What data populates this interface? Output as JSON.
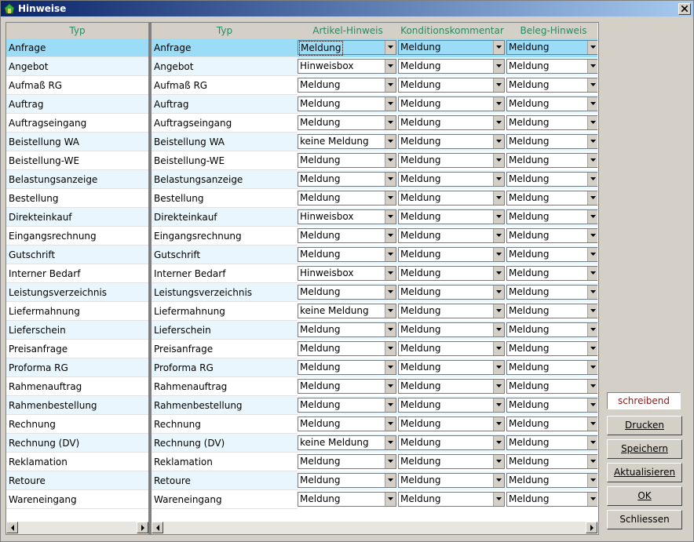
{
  "window": {
    "title": "Hinweise"
  },
  "columns": {
    "frozen_typ": "Typ",
    "typ": "Typ",
    "artikel": "Artikel-Hinweis",
    "kondition": "Konditionskommentar",
    "beleg": "Beleg-Hinweis"
  },
  "rows": [
    {
      "frozen": "Anfrage",
      "typ": "Anfrage",
      "artikel": "Meldung",
      "kondition": "Meldung",
      "beleg": "Meldung"
    },
    {
      "frozen": "Angebot",
      "typ": "Angebot",
      "artikel": "Hinweisbox",
      "kondition": "Meldung",
      "beleg": "Meldung"
    },
    {
      "frozen": "Aufmaß RG",
      "typ": "Aufmaß RG",
      "artikel": "Meldung",
      "kondition": "Meldung",
      "beleg": "Meldung"
    },
    {
      "frozen": "Auftrag",
      "typ": "Auftrag",
      "artikel": "Meldung",
      "kondition": "Meldung",
      "beleg": "Meldung"
    },
    {
      "frozen": "Auftragseingang",
      "typ": "Auftragseingang",
      "artikel": "Meldung",
      "kondition": "Meldung",
      "beleg": "Meldung"
    },
    {
      "frozen": "Beistellung WA",
      "typ": "Beistellung WA",
      "artikel": "keine Meldung",
      "kondition": "Meldung",
      "beleg": "Meldung"
    },
    {
      "frozen": "Beistellung-WE",
      "typ": "Beistellung-WE",
      "artikel": "Meldung",
      "kondition": "Meldung",
      "beleg": "Meldung"
    },
    {
      "frozen": "Belastungsanzeige",
      "typ": "Belastungsanzeige",
      "artikel": "Meldung",
      "kondition": "Meldung",
      "beleg": "Meldung"
    },
    {
      "frozen": "Bestellung",
      "typ": "Bestellung",
      "artikel": "Meldung",
      "kondition": "Meldung",
      "beleg": "Meldung"
    },
    {
      "frozen": "Direkteinkauf",
      "typ": "Direkteinkauf",
      "artikel": "Hinweisbox",
      "kondition": "Meldung",
      "beleg": "Meldung"
    },
    {
      "frozen": "Eingangsrechnung",
      "typ": "Eingangsrechnung",
      "artikel": "Meldung",
      "kondition": "Meldung",
      "beleg": "Meldung"
    },
    {
      "frozen": "Gutschrift",
      "typ": "Gutschrift",
      "artikel": "Meldung",
      "kondition": "Meldung",
      "beleg": "Meldung"
    },
    {
      "frozen": "Interner Bedarf",
      "typ": "Interner Bedarf",
      "artikel": "Hinweisbox",
      "kondition": "Meldung",
      "beleg": "Meldung"
    },
    {
      "frozen": "Leistungsverzeichnis",
      "typ": "Leistungsverzeichnis",
      "artikel": "Meldung",
      "kondition": "Meldung",
      "beleg": "Meldung"
    },
    {
      "frozen": "Liefermahnung",
      "typ": "Liefermahnung",
      "artikel": "keine Meldung",
      "kondition": "Meldung",
      "beleg": "Meldung"
    },
    {
      "frozen": "Lieferschein",
      "typ": "Lieferschein",
      "artikel": "Meldung",
      "kondition": "Meldung",
      "beleg": "Meldung"
    },
    {
      "frozen": "Preisanfrage",
      "typ": "Preisanfrage",
      "artikel": "Meldung",
      "kondition": "Meldung",
      "beleg": "Meldung"
    },
    {
      "frozen": "Proforma RG",
      "typ": "Proforma RG",
      "artikel": "Meldung",
      "kondition": "Meldung",
      "beleg": "Meldung"
    },
    {
      "frozen": "Rahmenauftrag",
      "typ": "Rahmenauftrag",
      "artikel": "Meldung",
      "kondition": "Meldung",
      "beleg": "Meldung"
    },
    {
      "frozen": "Rahmenbestellung",
      "typ": "Rahmenbestellung",
      "artikel": "Meldung",
      "kondition": "Meldung",
      "beleg": "Meldung"
    },
    {
      "frozen": "Rechnung",
      "typ": "Rechnung",
      "artikel": "Meldung",
      "kondition": "Meldung",
      "beleg": "Meldung"
    },
    {
      "frozen": "Rechnung (DV)",
      "typ": "Rechnung (DV)",
      "artikel": "keine Meldung",
      "kondition": "Meldung",
      "beleg": "Meldung"
    },
    {
      "frozen": "Reklamation",
      "typ": "Reklamation",
      "artikel": "Meldung",
      "kondition": "Meldung",
      "beleg": "Meldung"
    },
    {
      "frozen": "Retoure",
      "typ": "Retoure",
      "artikel": "Meldung",
      "kondition": "Meldung",
      "beleg": "Meldung"
    },
    {
      "frozen": "Wareneingang",
      "typ": "Wareneingang",
      "artikel": "Meldung",
      "kondition": "Meldung",
      "beleg": "Meldung"
    }
  ],
  "status": "schreibend",
  "buttons": {
    "drucken": "Drucken",
    "speichern": "Speichern",
    "aktualisieren": "Aktualisieren",
    "ok": "OK",
    "schliessen": "Schliessen"
  },
  "colors": {
    "header_text": "#2a8a5a",
    "selected_row": "#9bdcf7",
    "alt_row": "#eaf6fd",
    "status_text": "#8b1a1a"
  }
}
